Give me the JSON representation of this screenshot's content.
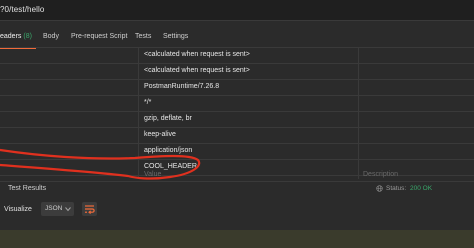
{
  "url_bar": {
    "text": "?0/test/hello"
  },
  "tabs": [
    {
      "label": "eaders",
      "count": "(8)"
    },
    {
      "label": "Body"
    },
    {
      "label": "Pre-request Script"
    },
    {
      "label": "Tests"
    },
    {
      "label": "Settings"
    }
  ],
  "headers_table": {
    "rows": [
      {
        "value": "<calculated when request is sent>"
      },
      {
        "value": "<calculated when request is sent>"
      },
      {
        "value": "PostmanRuntime/7.26.8"
      },
      {
        "value": "*/*"
      },
      {
        "value": "gzip, deflate, br"
      },
      {
        "value": "keep-alive"
      },
      {
        "value": "application/json"
      },
      {
        "value": "COOL_HEADER"
      }
    ],
    "new_row": {
      "value_placeholder": "Value",
      "description_placeholder": "Description"
    }
  },
  "response": {
    "test_results_label": "Test Results",
    "status_label": "Status:",
    "status_value": "200 OK",
    "visualize_label": "Visualize",
    "format_value": "JSON"
  },
  "colors": {
    "accent": "#f26b3a",
    "success": "#3aa86b",
    "annotation": "#e0301e"
  }
}
